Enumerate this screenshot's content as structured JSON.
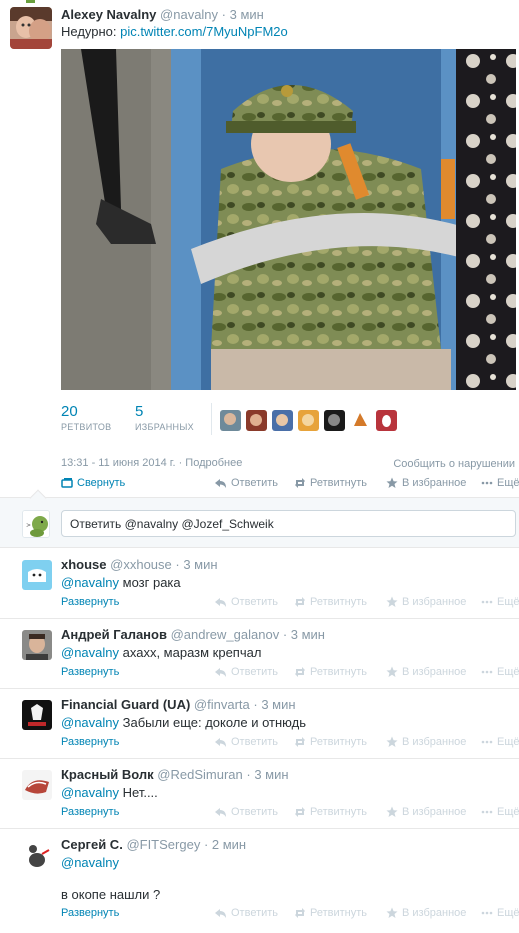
{
  "main_tweet": {
    "fullname": "Alexey Navalny",
    "username": "@navalny",
    "time": "· 3 мин",
    "text_prefix": "Недурно: ",
    "link": "pic.twitter.com/7MyuNpFM2o",
    "retweets": "20",
    "retweets_label": "РЕТВИТОВ",
    "favorites": "5",
    "favorites_label": "ИЗБРАННЫХ",
    "timestamp": "13:31 - 11 июня 2014 г.",
    "details_link": "· Подробнее",
    "report_link": "Сообщить о нарушении",
    "collapse_label": "Свернуть"
  },
  "actions": {
    "reply": "Ответить",
    "retweet": "Ретвитнуть",
    "favorite": "В избранное",
    "more": "Ещё",
    "expand": "Развернуть"
  },
  "reply_box": {
    "placeholder": "Ответить @navalny @Jozef_Schweik"
  },
  "replies": [
    {
      "fullname": "xhouse",
      "username": "@xxhouse",
      "time": "· 3 мин",
      "mention": "@navalny",
      "text": " мозг рака",
      "text2": ""
    },
    {
      "fullname": "Андрей Галанов",
      "username": "@andrew_galanov",
      "time": "· 3 мин",
      "mention": "@navalny",
      "text": " ахахх, маразм крепчал",
      "text2": ""
    },
    {
      "fullname": "Financial Guard (UA)",
      "username": "@finvarta",
      "time": "· 3 мин",
      "mention": "@navalny",
      "text": " Забыли еще: доколе и отнюдь",
      "text2": ""
    },
    {
      "fullname": "Красный Волк",
      "username": "@RedSimuran",
      "time": "· 3 мин",
      "mention": "@navalny",
      "text": " Нет....",
      "text2": ""
    },
    {
      "fullname": "Сергей С.",
      "username": "@FITSergey",
      "time": "· 2 мин",
      "mention": "@navalny",
      "text": "",
      "text2": "в окопе нашли ?"
    }
  ],
  "icons": {
    "reply": "reply-arrow-icon",
    "retweet": "retweet-icon",
    "favorite": "star-icon",
    "more": "more-dots-icon",
    "collapse": "collapse-icon"
  },
  "colors": {
    "link": "#0084b4",
    "muted": "#8899a6"
  }
}
